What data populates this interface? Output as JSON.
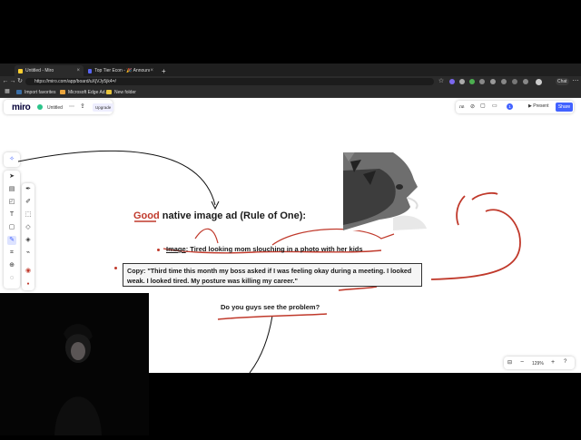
{
  "browser": {
    "tabs": [
      {
        "label": "Untitled - Miro",
        "active": true
      },
      {
        "label": "Top Tier Econ - 🎉 Announceme",
        "active": false
      }
    ],
    "new_tab": "+",
    "url": "https://miro.com/app/board/uXjVJy5jk4=/",
    "bookmarks": [
      "Import favorites",
      "Microsoft Edge Ad...",
      "New folder"
    ],
    "profile": "Chat"
  },
  "miro": {
    "logo": "miro",
    "board_name": "Untitled",
    "upgrade_label": "Upgrade",
    "present_label": "Present",
    "share_label": "Share",
    "zoom": "129%",
    "avatar": "1"
  },
  "content": {
    "heading_good": "Good",
    "heading_rest": " native image ad (Rule of One):",
    "image_label": "Image",
    "image_text": ": Tired looking mom slouching in a photo with her kids",
    "copy_text": "Copy: \"Third time this month my boss asked if I was feeling okay during a meeting. I looked weak. I looked tired. My posture was killing my career.\"",
    "question": "Do you guys see the problem?"
  },
  "colors": {
    "accent": "#4262ff",
    "annotation": "#c0392b"
  }
}
